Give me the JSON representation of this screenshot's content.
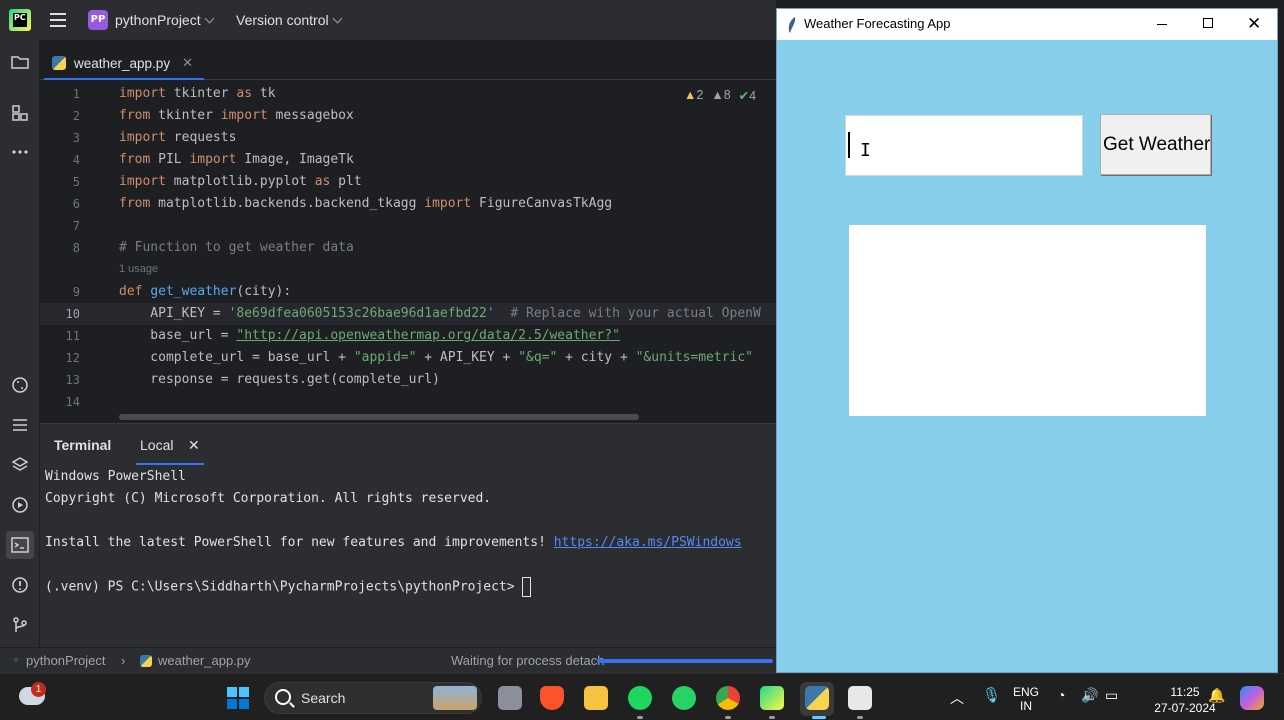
{
  "ide": {
    "project_badge": "PP",
    "project_name": "pythonProject",
    "version_control": "Version control",
    "tab_label": "weather_app.py",
    "inspections": {
      "warnings_a": "2",
      "warnings_b": "8",
      "ok": "4"
    },
    "code_lines": [
      {
        "n": "1"
      },
      {
        "n": "2"
      },
      {
        "n": "3"
      },
      {
        "n": "4"
      },
      {
        "n": "5"
      },
      {
        "n": "6"
      },
      {
        "n": "7"
      },
      {
        "n": "8"
      },
      {
        "n": "9"
      },
      {
        "n": "10"
      },
      {
        "n": "11"
      },
      {
        "n": "12"
      },
      {
        "n": "13"
      },
      {
        "n": "14"
      }
    ],
    "code": {
      "l1": [
        "import",
        " tkinter ",
        "as",
        " tk"
      ],
      "l2": [
        "from",
        " tkinter ",
        "import",
        " messagebox"
      ],
      "l3": [
        "import",
        " requests"
      ],
      "l4": [
        "from",
        " PIL ",
        "import",
        " Image, ImageTk"
      ],
      "l5": [
        "import",
        " matplotlib.pyplot ",
        "as",
        " plt"
      ],
      "l6": [
        "from",
        " matplotlib.backends.backend_tkagg ",
        "import",
        " FigureCanvasTkAgg"
      ],
      "l8": "# Function to get weather data",
      "usage": "1 usage",
      "l9": [
        "def",
        " ",
        "get_weather",
        "(city):"
      ],
      "l10": [
        "    API_KEY = ",
        "'8e69dfea0605153c26bae96d1aefbd22'",
        "  # Replace with your actual OpenW"
      ],
      "l11": [
        "    base_url = ",
        "\"http://api.openweathermap.org/data/2.5/weather?\""
      ],
      "l12": [
        "    complete_url = base_url + ",
        "\"appid=\"",
        " + API_KEY + ",
        "\"&q=\"",
        " + city + ",
        "\"&units=metric\""
      ],
      "l13": "    response = requests.get(complete_url)"
    },
    "terminal": {
      "tab_terminal": "Terminal",
      "tab_local": "Local",
      "line1": "Windows PowerShell",
      "line2": "Copyright (C) Microsoft Corporation. All rights reserved.",
      "line3_prefix": "Install the latest PowerShell for new features and improvements! ",
      "line3_link": "https://aka.ms/PSWindows",
      "prompt": "(.venv) PS C:\\Users\\Siddharth\\PycharmProjects\\pythonProject> "
    },
    "status": {
      "crumb_project": "pythonProject",
      "crumb_file": "weather_app.py",
      "message": "Waiting for process detach",
      "progress": 1.0
    }
  },
  "weather_app": {
    "title": "Weather Forecasting App",
    "entry_value": "",
    "button_label": "Get Weather",
    "bg_color": "#87ceeb"
  },
  "taskbar": {
    "notification_count": "1",
    "search_placeholder": "Search",
    "lang_line1": "ENG",
    "lang_line2": "IN",
    "time": "11:25",
    "date": "27-07-2024"
  }
}
